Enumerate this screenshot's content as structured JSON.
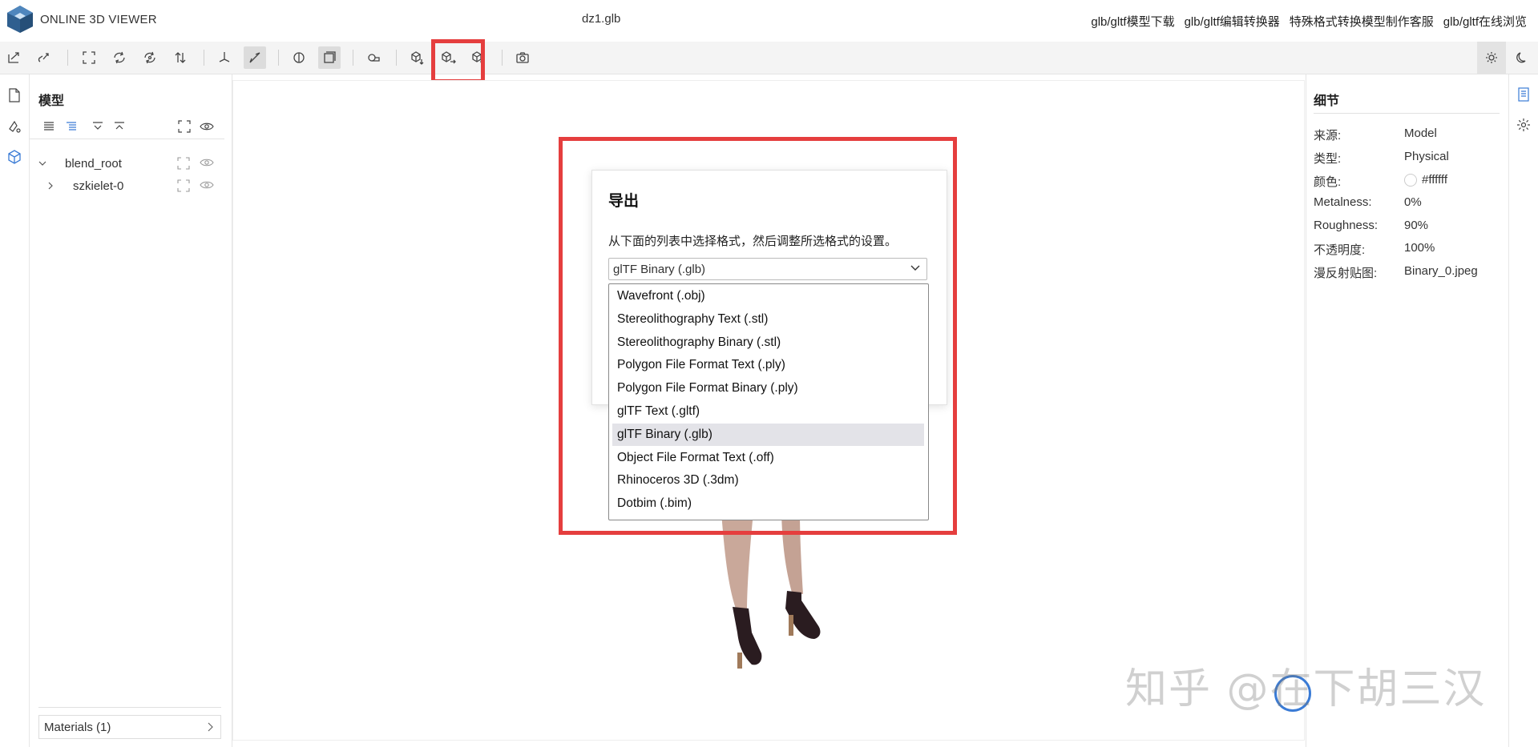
{
  "app": {
    "logo_text": "ONLINE 3D VIEWER",
    "file_title": "dz1.glb"
  },
  "top_links": [
    "glb/gltf模型下载",
    "glb/gltf编辑转换器",
    "特殊格式转换模型制作客服",
    "glb/gltf在线浏览"
  ],
  "toolbar_icons": [
    "open-file",
    "open-url",
    "fit-to-window",
    "up-y",
    "up-z",
    "flip-up",
    "fix-up",
    "edit-measure",
    "toggle-xray",
    "toggle-edges",
    "snapshot-preview",
    "import-cube",
    "export-cube",
    "share-cube",
    "camera",
    "light-mode",
    "dark-mode"
  ],
  "left_panel": {
    "title": "模型",
    "tree": [
      {
        "label": "blend_root",
        "expanded": true
      },
      {
        "label": "szkielet-0",
        "expanded": false
      }
    ],
    "materials_label": "Materials (1)"
  },
  "right_panel": {
    "title": "细节",
    "properties": [
      {
        "name": "来源:",
        "value": "Model"
      },
      {
        "name": "类型:",
        "value": "Physical"
      },
      {
        "name": "颜色:",
        "value": "#ffffff",
        "swatch": "#ffffff"
      },
      {
        "name": "Metalness:",
        "value": "0%"
      },
      {
        "name": "Roughness:",
        "value": "90%"
      },
      {
        "name": "不透明度:",
        "value": "100%"
      },
      {
        "name": "漫反射贴图:",
        "value": "Binary_0.jpeg"
      }
    ]
  },
  "export_dialog": {
    "title": "导出",
    "description": "从下面的列表中选择格式，然后调整所选格式的设置。",
    "selected_format": "glTF Binary (.glb)",
    "options": [
      "Wavefront (.obj)",
      "Stereolithography Text (.stl)",
      "Stereolithography Binary (.stl)",
      "Polygon File Format Text (.ply)",
      "Polygon File Format Binary (.ply)",
      "glTF Text (.gltf)",
      "glTF Binary (.glb)",
      "Object File Format Text (.off)",
      "Rhinoceros 3D (.3dm)",
      "Dotbim (.bim)"
    ],
    "highlighted_option_index": 6
  },
  "watermark": "知乎 @在下胡三汉",
  "colors": {
    "highlight": "#e53e3e",
    "accent": "#3a7bd5"
  }
}
